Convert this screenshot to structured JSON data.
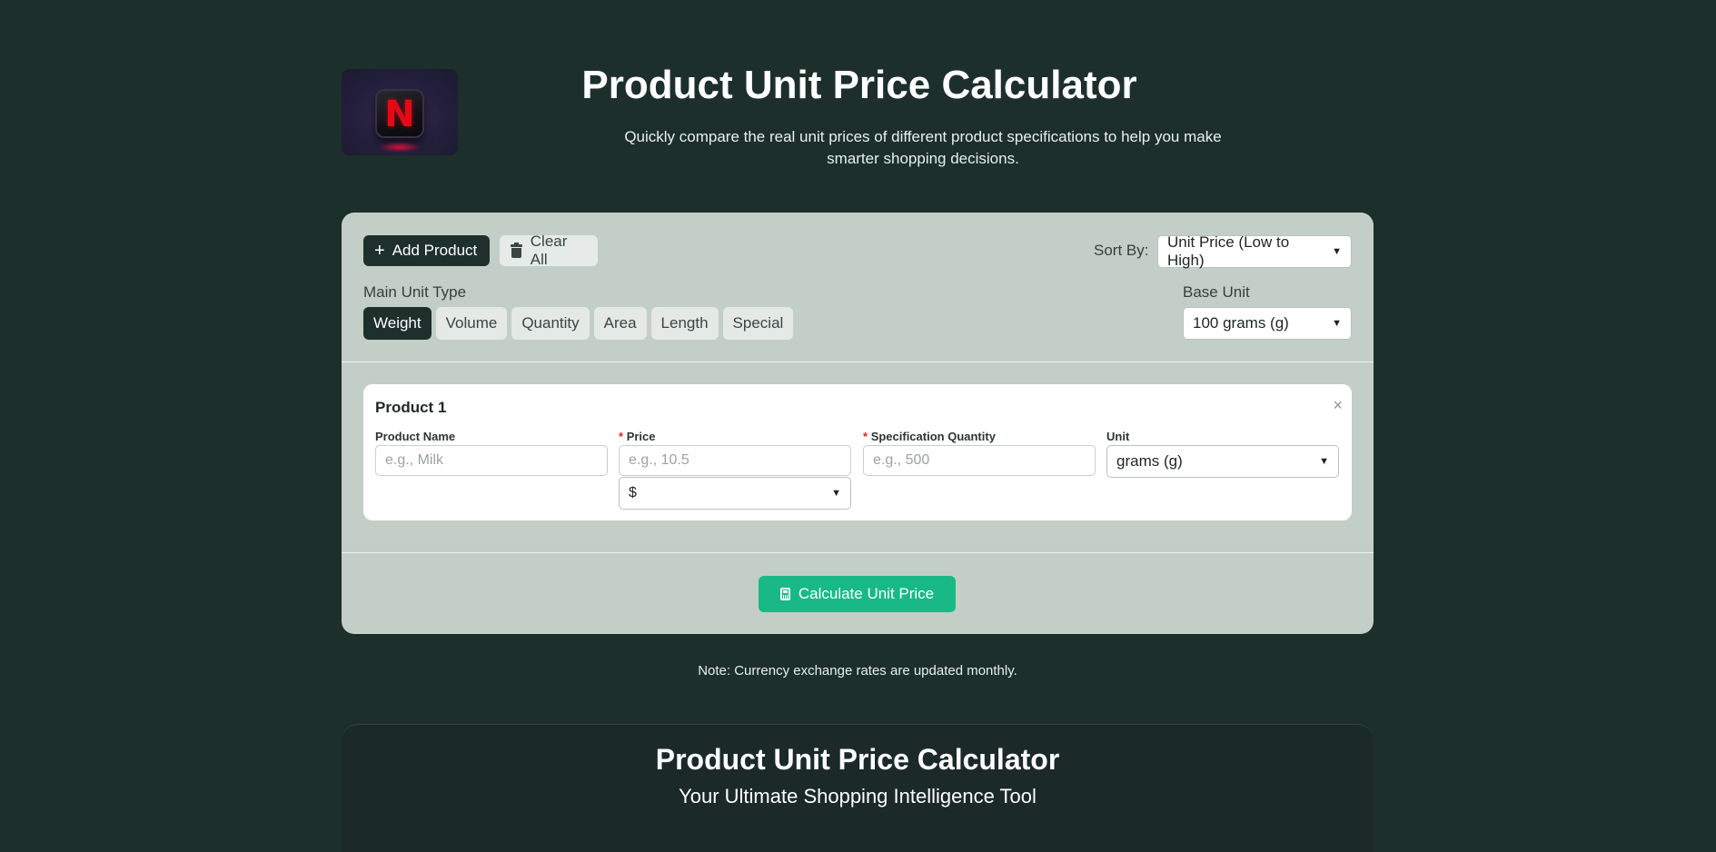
{
  "header": {
    "title": "Product Unit Price Calculator",
    "subtitle": "Quickly compare the real unit prices of different product specifications to help you make smarter shopping decisions.",
    "logo_letter": "N"
  },
  "toolbar": {
    "add_label": "Add Product",
    "clear_label": "Clear All",
    "sort_label": "Sort By:",
    "sort_value": "Unit Price (Low to High)"
  },
  "units": {
    "type_label": "Main Unit Type",
    "tabs": [
      "Weight",
      "Volume",
      "Quantity",
      "Area",
      "Length",
      "Special"
    ],
    "active_tab": "Weight",
    "base_label": "Base Unit",
    "base_value": "100 grams (g)"
  },
  "product": {
    "title": "Product 1",
    "name_label": "Product Name",
    "name_placeholder": "e.g., Milk",
    "price_label": "Price",
    "price_placeholder": "e.g., 10.5",
    "currency_value": "$",
    "spec_label": "Specification Quantity",
    "spec_placeholder": "e.g., 500",
    "unit_label": "Unit",
    "unit_value": "grams (g)",
    "required_mark": "*",
    "close_glyph": "×"
  },
  "actions": {
    "calculate_label": "Calculate Unit Price"
  },
  "note": "Note: Currency exchange rates are updated monthly.",
  "footer_section": {
    "title": "Product Unit Price Calculator",
    "subtitle": "Your Ultimate Shopping Intelligence Tool"
  },
  "colors": {
    "background": "#1d2f2b",
    "card": "#c3cfc6",
    "accent_dark": "#1f302c",
    "calculate_green": "#18b985"
  }
}
